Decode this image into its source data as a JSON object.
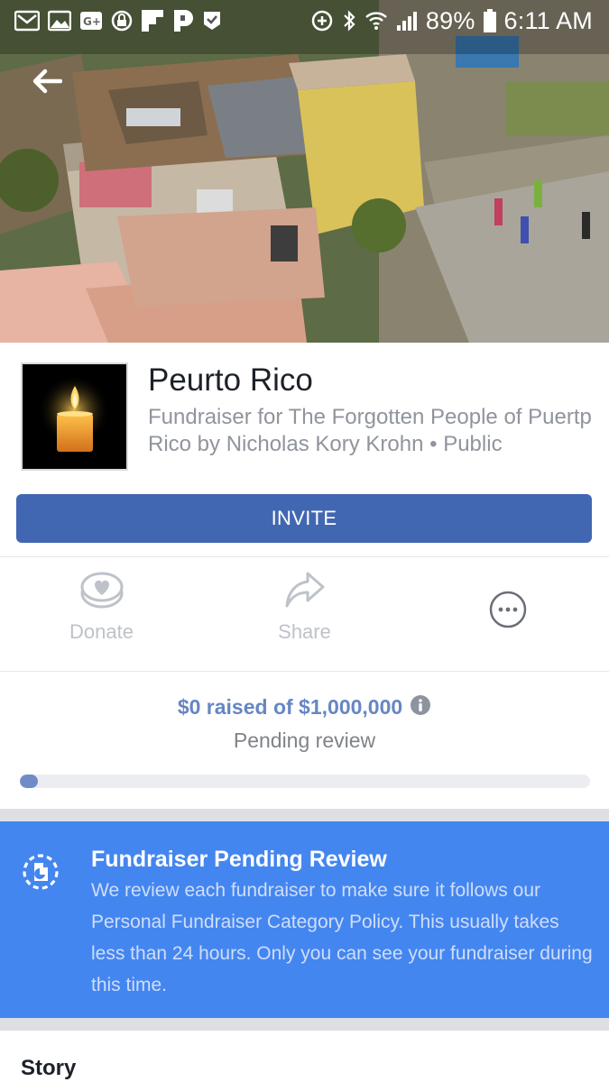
{
  "status_bar": {
    "battery": "89%",
    "time": "6:11 AM",
    "left_icons": [
      "gmail-icon",
      "gallery-icon",
      "google-plus-icon",
      "lock-app-icon",
      "flipboard-icon",
      "pandora-icon",
      "check-app-icon"
    ],
    "right_icons": [
      "data-saver-icon",
      "bluetooth-icon",
      "wifi-icon",
      "signal-icon",
      "battery-icon"
    ]
  },
  "header": {
    "title": "Peurto Rico",
    "subtitle": "Fundraiser for The Forgotten People of Puertp Rico by Nicholas Kory Krohn • Public"
  },
  "invite": {
    "label": "INVITE"
  },
  "actions": [
    {
      "label": "Donate",
      "icon": "donate-coin-heart-icon"
    },
    {
      "label": "Share",
      "icon": "share-arrow-icon"
    },
    {
      "label": "",
      "icon": "more-options-icon"
    }
  ],
  "progress": {
    "raised": "$0 raised of $1,000,000",
    "status": "Pending review",
    "fraction": 0.0
  },
  "banner": {
    "title": "Fundraiser Pending Review",
    "body": "We review each fundraiser to make sure it follows our Personal Fundraiser Category Policy. This usually takes less than 24 hours. Only you can see your fundraiser during this time."
  },
  "story": {
    "title": "Story"
  },
  "colors": {
    "primary": "#4267b2",
    "banner": "#4486f0",
    "raised_text": "#6686c3",
    "muted": "#90949c"
  }
}
